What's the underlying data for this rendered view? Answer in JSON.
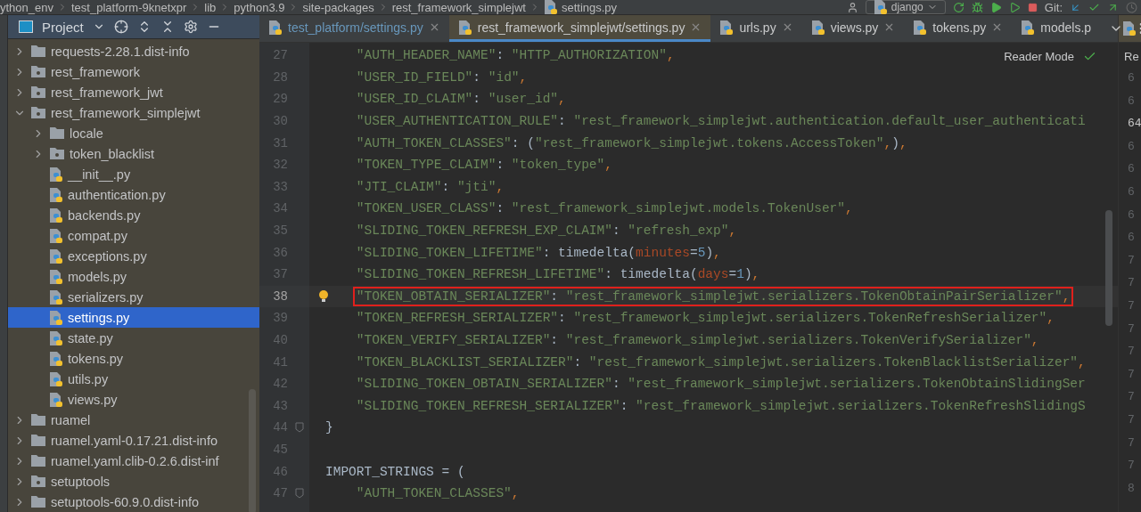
{
  "breadcrumbs": [
    "ython_env",
    "test_platform-9knetxpr",
    "lib",
    "python3.9",
    "site-packages",
    "rest_framework_simplejwt",
    "settings.py"
  ],
  "toolbar": {
    "run_config": "django",
    "vcs_label": "Git:"
  },
  "project_panel": {
    "title": "Project",
    "tree": [
      {
        "label": "requests-2.28.1.dist-info",
        "kind": "folder",
        "expanded": false,
        "selected": false
      },
      {
        "label": "rest_framework",
        "kind": "package",
        "expanded": false,
        "selected": false
      },
      {
        "label": "rest_framework_jwt",
        "kind": "package",
        "expanded": false,
        "selected": false
      },
      {
        "label": "rest_framework_simplejwt",
        "kind": "package",
        "expanded": true,
        "selected": false,
        "children": [
          {
            "label": "locale",
            "kind": "folder",
            "expanded": false,
            "selected": false
          },
          {
            "label": "token_blacklist",
            "kind": "package",
            "expanded": false,
            "selected": false
          },
          {
            "label": "__init__.py",
            "kind": "python",
            "selected": false
          },
          {
            "label": "authentication.py",
            "kind": "python",
            "selected": false
          },
          {
            "label": "backends.py",
            "kind": "python",
            "selected": false
          },
          {
            "label": "compat.py",
            "kind": "python",
            "selected": false
          },
          {
            "label": "exceptions.py",
            "kind": "python",
            "selected": false
          },
          {
            "label": "models.py",
            "kind": "python",
            "selected": false
          },
          {
            "label": "serializers.py",
            "kind": "python",
            "selected": false
          },
          {
            "label": "settings.py",
            "kind": "python",
            "selected": true
          },
          {
            "label": "state.py",
            "kind": "python",
            "selected": false
          },
          {
            "label": "tokens.py",
            "kind": "python",
            "selected": false
          },
          {
            "label": "utils.py",
            "kind": "python",
            "selected": false
          },
          {
            "label": "views.py",
            "kind": "python",
            "selected": false
          }
        ]
      },
      {
        "label": "ruamel",
        "kind": "folder",
        "expanded": false,
        "selected": false
      },
      {
        "label": "ruamel.yaml-0.17.21.dist-info",
        "kind": "folder",
        "expanded": false,
        "selected": false
      },
      {
        "label": "ruamel.yaml.clib-0.2.6.dist-inf",
        "kind": "folder",
        "expanded": false,
        "selected": false
      },
      {
        "label": "setuptools",
        "kind": "package",
        "expanded": false,
        "selected": false
      },
      {
        "label": "setuptools-60.9.0.dist-info",
        "kind": "folder",
        "expanded": false,
        "selected": false
      }
    ]
  },
  "tabs": [
    {
      "label": "test_platform/settings.py",
      "selected": false,
      "vcs_modified": true,
      "closable": true
    },
    {
      "label": "rest_framework_simplejwt/settings.py",
      "selected": true,
      "vcs_modified": false,
      "closable": true
    },
    {
      "label": "urls.py",
      "selected": false,
      "vcs_modified": false,
      "closable": true
    },
    {
      "label": "views.py",
      "selected": false,
      "vcs_modified": false,
      "closable": true
    },
    {
      "label": "tokens.py",
      "selected": false,
      "vcs_modified": false,
      "closable": true
    },
    {
      "label": "models.p",
      "selected": false,
      "vcs_modified": false,
      "closable": false
    }
  ],
  "editor": {
    "reader_mode": "Reader Mode",
    "lines": [
      {
        "number": "27",
        "current": false,
        "highlighted": false,
        "indented": true,
        "tokens": [
          {
            "kind": "str",
            "text": "\"AUTH_HEADER_NAME\""
          },
          {
            "kind": "plain",
            "text": ": "
          },
          {
            "kind": "str",
            "text": "\"HTTP_AUTHORIZATION\""
          },
          {
            "kind": "comma",
            "text": ","
          }
        ]
      },
      {
        "number": "28",
        "current": false,
        "highlighted": false,
        "indented": true,
        "tokens": [
          {
            "kind": "str",
            "text": "\"USER_ID_FIELD\""
          },
          {
            "kind": "plain",
            "text": ": "
          },
          {
            "kind": "str",
            "text": "\"id\""
          },
          {
            "kind": "comma",
            "text": ","
          }
        ]
      },
      {
        "number": "29",
        "current": false,
        "highlighted": false,
        "indented": true,
        "tokens": [
          {
            "kind": "str",
            "text": "\"USER_ID_CLAIM\""
          },
          {
            "kind": "plain",
            "text": ": "
          },
          {
            "kind": "str",
            "text": "\"user_id\""
          },
          {
            "kind": "comma",
            "text": ","
          }
        ]
      },
      {
        "number": "30",
        "current": false,
        "highlighted": false,
        "indented": true,
        "tokens": [
          {
            "kind": "str",
            "text": "\"USER_AUTHENTICATION_RULE\""
          },
          {
            "kind": "plain",
            "text": ": "
          },
          {
            "kind": "str",
            "text": "\"rest_framework_simplejwt.authentication.default_user_authenticati"
          }
        ]
      },
      {
        "number": "31",
        "current": false,
        "highlighted": false,
        "indented": true,
        "tokens": [
          {
            "kind": "str",
            "text": "\"AUTH_TOKEN_CLASSES\""
          },
          {
            "kind": "plain",
            "text": ": ("
          },
          {
            "kind": "str",
            "text": "\"rest_framework_simplejwt.tokens.AccessToken\""
          },
          {
            "kind": "comma",
            "text": ","
          },
          {
            "kind": "plain",
            "text": ")"
          },
          {
            "kind": "comma",
            "text": ","
          }
        ]
      },
      {
        "number": "32",
        "current": false,
        "highlighted": false,
        "indented": true,
        "tokens": [
          {
            "kind": "str",
            "text": "\"TOKEN_TYPE_CLAIM\""
          },
          {
            "kind": "plain",
            "text": ": "
          },
          {
            "kind": "str",
            "text": "\"token_type\""
          },
          {
            "kind": "comma",
            "text": ","
          }
        ]
      },
      {
        "number": "33",
        "current": false,
        "highlighted": false,
        "indented": true,
        "tokens": [
          {
            "kind": "str",
            "text": "\"JTI_CLAIM\""
          },
          {
            "kind": "plain",
            "text": ": "
          },
          {
            "kind": "str",
            "text": "\"jti\""
          },
          {
            "kind": "comma",
            "text": ","
          }
        ]
      },
      {
        "number": "34",
        "current": false,
        "highlighted": false,
        "indented": true,
        "tokens": [
          {
            "kind": "str",
            "text": "\"TOKEN_USER_CLASS\""
          },
          {
            "kind": "plain",
            "text": ": "
          },
          {
            "kind": "str",
            "text": "\"rest_framework_simplejwt.models.TokenUser\""
          },
          {
            "kind": "comma",
            "text": ","
          }
        ]
      },
      {
        "number": "35",
        "current": false,
        "highlighted": false,
        "indented": true,
        "tokens": [
          {
            "kind": "str",
            "text": "\"SLIDING_TOKEN_REFRESH_EXP_CLAIM\""
          },
          {
            "kind": "plain",
            "text": ": "
          },
          {
            "kind": "str",
            "text": "\"refresh_exp\""
          },
          {
            "kind": "comma",
            "text": ","
          }
        ]
      },
      {
        "number": "36",
        "current": false,
        "highlighted": false,
        "indented": true,
        "tokens": [
          {
            "kind": "str",
            "text": "\"SLIDING_TOKEN_LIFETIME\""
          },
          {
            "kind": "plain",
            "text": ": timedelta("
          },
          {
            "kind": "kwarg",
            "text": "minutes"
          },
          {
            "kind": "plain",
            "text": "="
          },
          {
            "kind": "num",
            "text": "5"
          },
          {
            "kind": "plain",
            "text": ")"
          },
          {
            "kind": "comma",
            "text": ","
          }
        ]
      },
      {
        "number": "37",
        "current": false,
        "highlighted": false,
        "indented": true,
        "tokens": [
          {
            "kind": "str",
            "text": "\"SLIDING_TOKEN_REFRESH_LIFETIME\""
          },
          {
            "kind": "plain",
            "text": ": timedelta("
          },
          {
            "kind": "kwarg",
            "text": "days"
          },
          {
            "kind": "plain",
            "text": "="
          },
          {
            "kind": "num",
            "text": "1"
          },
          {
            "kind": "plain",
            "text": ")"
          },
          {
            "kind": "comma",
            "text": ","
          }
        ]
      },
      {
        "number": "38",
        "current": true,
        "highlighted": true,
        "indented": true,
        "has_bulb": true,
        "tokens": [
          {
            "kind": "str",
            "text": "\"TOKEN_OBTAIN_SERIALIZER\""
          },
          {
            "kind": "plain",
            "text": ": "
          },
          {
            "kind": "str",
            "text": "\"rest_framework_simplejwt.serializers.TokenObtainPairSerializer\""
          },
          {
            "kind": "comma",
            "text": ","
          }
        ]
      },
      {
        "number": "39",
        "current": false,
        "highlighted": false,
        "indented": true,
        "tokens": [
          {
            "kind": "str",
            "text": "\"TOKEN_REFRESH_SERIALIZER\""
          },
          {
            "kind": "plain",
            "text": ": "
          },
          {
            "kind": "str",
            "text": "\"rest_framework_simplejwt.serializers.TokenRefreshSerializer\""
          },
          {
            "kind": "comma",
            "text": ","
          }
        ]
      },
      {
        "number": "40",
        "current": false,
        "highlighted": false,
        "indented": true,
        "tokens": [
          {
            "kind": "str",
            "text": "\"TOKEN_VERIFY_SERIALIZER\""
          },
          {
            "kind": "plain",
            "text": ": "
          },
          {
            "kind": "str",
            "text": "\"rest_framework_simplejwt.serializers.TokenVerifySerializer\""
          },
          {
            "kind": "comma",
            "text": ","
          }
        ]
      },
      {
        "number": "41",
        "current": false,
        "highlighted": false,
        "indented": true,
        "tokens": [
          {
            "kind": "str",
            "text": "\"TOKEN_BLACKLIST_SERIALIZER\""
          },
          {
            "kind": "plain",
            "text": ": "
          },
          {
            "kind": "str",
            "text": "\"rest_framework_simplejwt.serializers.TokenBlacklistSerializer\""
          },
          {
            "kind": "comma",
            "text": ","
          }
        ]
      },
      {
        "number": "42",
        "current": false,
        "highlighted": false,
        "indented": true,
        "tokens": [
          {
            "kind": "str",
            "text": "\"SLIDING_TOKEN_OBTAIN_SERIALIZER\""
          },
          {
            "kind": "plain",
            "text": ": "
          },
          {
            "kind": "str",
            "text": "\"rest_framework_simplejwt.serializers.TokenObtainSlidingSer"
          }
        ]
      },
      {
        "number": "43",
        "current": false,
        "highlighted": false,
        "indented": true,
        "tokens": [
          {
            "kind": "str",
            "text": "\"SLIDING_TOKEN_REFRESH_SERIALIZER\""
          },
          {
            "kind": "plain",
            "text": ": "
          },
          {
            "kind": "str",
            "text": "\"rest_framework_simplejwt.serializers.TokenRefreshSlidingS"
          }
        ]
      },
      {
        "number": "44",
        "current": false,
        "highlighted": false,
        "indented": false,
        "foldable": true,
        "tokens": [
          {
            "kind": "plain",
            "text": "}"
          }
        ]
      },
      {
        "number": "45",
        "current": false
      },
      {
        "number": "46",
        "current": false,
        "highlighted": false,
        "indented": false,
        "tokens": [
          {
            "kind": "plain",
            "text": "IMPORT_STRINGS = ("
          }
        ]
      },
      {
        "number": "47",
        "current": false,
        "highlighted": false,
        "indented": true,
        "foldable": true,
        "tokens": [
          {
            "kind": "str",
            "text": "\"AUTH_TOKEN_CLASSES\""
          },
          {
            "kind": "comma",
            "text": ","
          }
        ]
      }
    ]
  },
  "right_pane": {
    "reader_mode": "Re",
    "line_numbers": [
      {
        "number": "6",
        "current": false
      },
      {
        "number": "6",
        "current": false
      },
      {
        "number": "64",
        "current": true
      },
      {
        "number": "6",
        "current": false
      },
      {
        "number": "6",
        "current": false
      },
      {
        "number": "6",
        "current": false
      },
      {
        "number": "6",
        "current": false
      },
      {
        "number": "6",
        "current": false
      },
      {
        "number": "7",
        "current": false
      },
      {
        "number": "7",
        "current": false
      },
      {
        "number": "7",
        "current": false
      },
      {
        "number": "7",
        "current": false
      },
      {
        "number": "7",
        "current": false
      },
      {
        "number": "7",
        "current": false
      },
      {
        "number": "7",
        "current": false
      },
      {
        "number": "7",
        "current": false
      },
      {
        "number": "7",
        "current": false
      },
      {
        "number": "7",
        "current": false
      },
      {
        "number": "8",
        "current": false
      }
    ]
  }
}
